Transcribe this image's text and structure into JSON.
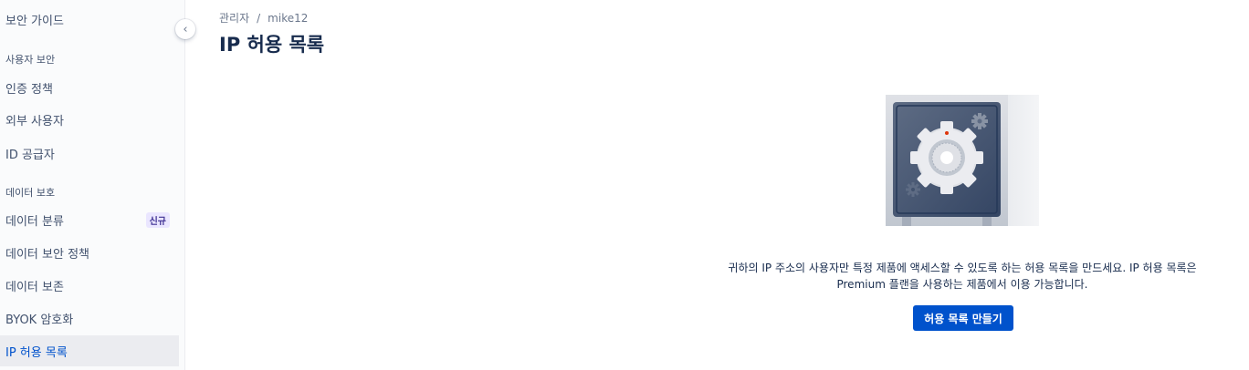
{
  "sidebar": {
    "top_item": "보안 가이드",
    "sections": [
      {
        "title": "사용자 보안",
        "items": [
          "인증 정책",
          "외부 사용자",
          "ID 공급자"
        ]
      },
      {
        "title": "데이터 보호",
        "items": [
          "데이터 분류",
          "데이터 보안 정책",
          "데이터 보존",
          "BYOK 암호화",
          "IP 허용 목록"
        ]
      }
    ],
    "new_badge": "신규",
    "active_item": "IP 허용 목록"
  },
  "breadcrumb": {
    "items": [
      "관리자",
      "mike12"
    ],
    "separator": "/"
  },
  "page": {
    "title": "IP 허용 목록",
    "description_line1": "귀하의 IP 주소의 사용자만 특정 제품에 액세스할 수 있도록 하는 허용 목록을 만드세요. IP 허용 목록은",
    "description_line2": "Premium 플랜을 사용하는 제품에서 이용 가능합니다.",
    "create_button": "허용 목록 만들기"
  },
  "colors": {
    "primary": "#0052cc",
    "sidebar_bg": "#fafbfc",
    "active_bg": "#ebecf0",
    "badge_bg": "#eae6ff",
    "badge_text": "#403294",
    "text": "#172b4d",
    "subtle_text": "#6b778c"
  }
}
